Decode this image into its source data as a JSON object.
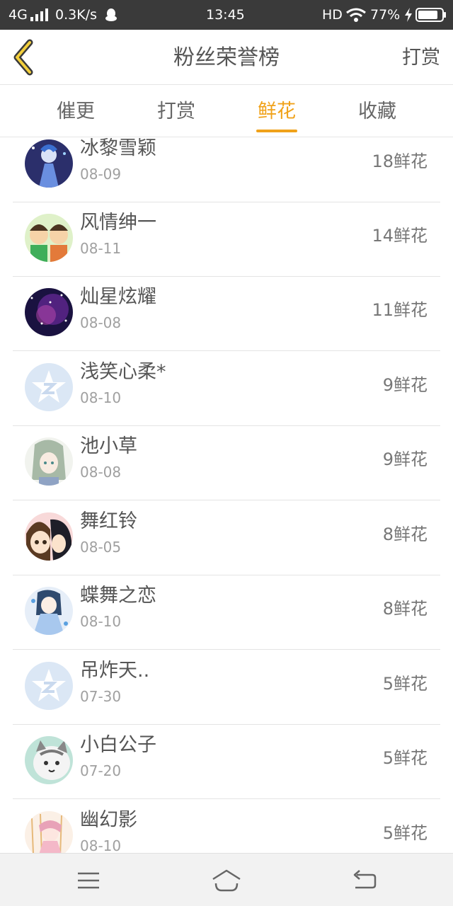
{
  "status_bar": {
    "network": "4G",
    "speed": "0.3K/s",
    "time": "13:45",
    "hd": "HD",
    "battery": "77%"
  },
  "header": {
    "title": "粉丝荣誉榜",
    "action_label": "打赏"
  },
  "tabs": [
    {
      "label": "催更",
      "active": false
    },
    {
      "label": "打赏",
      "active": false
    },
    {
      "label": "鲜花",
      "active": true
    },
    {
      "label": "收藏",
      "active": false
    }
  ],
  "accent_color": "#f0a21a",
  "fans": [
    {
      "name": "冰黎雪颖",
      "date": "08-09",
      "count": "18鲜花",
      "avatar": "anime-girl-blue"
    },
    {
      "name": "风情绅一",
      "date": "08-11",
      "count": "14鲜花",
      "avatar": "cartoon-pair"
    },
    {
      "name": "灿星炫耀",
      "date": "08-08",
      "count": "11鲜花",
      "avatar": "starry-sky"
    },
    {
      "name": "浅笑心柔*",
      "date": "08-10",
      "count": "9鲜花",
      "avatar": "default-star-avatar"
    },
    {
      "name": "池小草",
      "date": "08-08",
      "count": "9鲜花",
      "avatar": "anime-girl-green"
    },
    {
      "name": "舞红铃",
      "date": "08-05",
      "count": "8鲜花",
      "avatar": "anime-duo"
    },
    {
      "name": "蝶舞之恋",
      "date": "08-10",
      "count": "8鲜花",
      "avatar": "anime-girl-lightblue"
    },
    {
      "name": "吊炸天..",
      "date": "07-30",
      "count": "5鲜花",
      "avatar": "default-star-avatar"
    },
    {
      "name": "小白公子",
      "date": "07-20",
      "count": "5鲜花",
      "avatar": "cartoon-cat"
    },
    {
      "name": "幽幻影",
      "date": "08-10",
      "count": "5鲜花",
      "avatar": "anime-pink"
    }
  ],
  "nav_bar": {
    "icons": [
      "menu-icon",
      "home-icon",
      "back-icon"
    ]
  }
}
